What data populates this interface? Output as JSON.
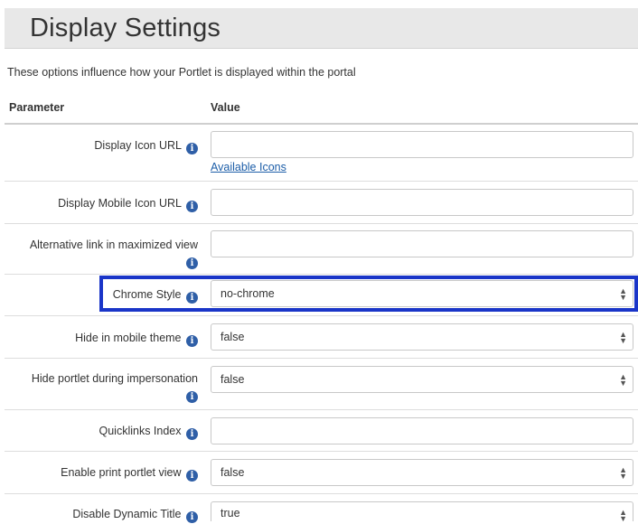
{
  "header": {
    "title": "Display Settings"
  },
  "description": "These options influence how your Portlet is displayed within the portal",
  "table": {
    "col_parameter": "Parameter",
    "col_value": "Value",
    "rows": [
      {
        "label": "Display Icon URL",
        "type": "text",
        "value": "",
        "link": "Available Icons"
      },
      {
        "label": "Display Mobile Icon URL",
        "type": "text",
        "value": ""
      },
      {
        "label_line1": "Alternative link in maximized view",
        "type": "text",
        "value": ""
      },
      {
        "label": "Chrome Style",
        "type": "select",
        "value": "no-chrome",
        "highlighted": true
      },
      {
        "label": "Hide in mobile theme",
        "type": "select",
        "value": "false"
      },
      {
        "label_line1": "Hide portlet during impersonation",
        "type": "select",
        "value": "false"
      },
      {
        "label": "Quicklinks Index",
        "type": "text",
        "value": ""
      },
      {
        "label": "Enable print portlet view",
        "type": "select",
        "value": "false"
      },
      {
        "label": "Disable Dynamic Title",
        "type": "select",
        "value": "true"
      }
    ]
  },
  "icons": {
    "info": "info-icon",
    "select_arrow": "select-arrow-icon"
  },
  "colors": {
    "highlight_border": "#1a35c8",
    "link": "#1d5ea8",
    "info_icon": "#2f5fa7",
    "header_bg": "#e8e8e8"
  }
}
